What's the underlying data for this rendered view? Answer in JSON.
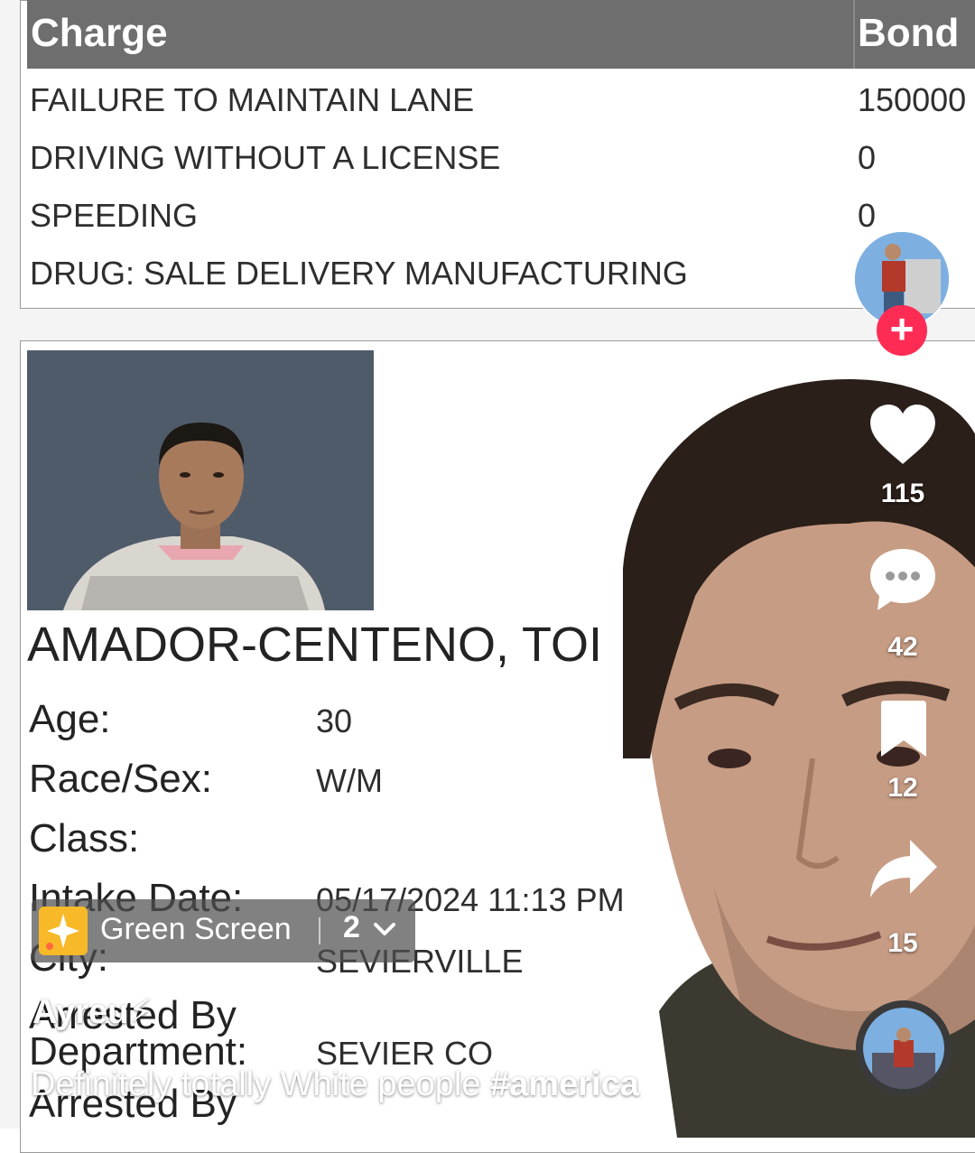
{
  "charges": {
    "header_charge": "Charge",
    "header_bond": "Bond",
    "rows": [
      {
        "charge": "FAILURE TO MAINTAIN LANE",
        "bond": "150000"
      },
      {
        "charge": "DRIVING WITHOUT A LICENSE",
        "bond": "0"
      },
      {
        "charge": "SPEEDING",
        "bond": "0"
      },
      {
        "charge": "DRUG: SALE DELIVERY MANUFACTURING",
        "bond": ""
      }
    ]
  },
  "record": {
    "name": "AMADOR-CENTENO, TOI",
    "fields": [
      {
        "label": "Age:",
        "value": "30"
      },
      {
        "label": "Race/Sex:",
        "value": "W/M"
      },
      {
        "label": "Class:",
        "value": ""
      },
      {
        "label": "Intake Date:",
        "value": "05/17/2024 11:13 PM"
      },
      {
        "label": "City:",
        "value": "SEVIERVILLE"
      },
      {
        "label": "Arrested By",
        "value": ""
      },
      {
        "label": "Department:",
        "value": "SEVIER CO"
      },
      {
        "label": "Arrested By",
        "value": ""
      }
    ]
  },
  "actions": {
    "likes": "115",
    "comments": "42",
    "saves": "12",
    "shares": "15"
  },
  "effect": {
    "name": "Green Screen",
    "count": "2"
  },
  "video": {
    "username": "Ayreu⚡",
    "caption_text": "Definitely totally White people ",
    "hashtag": "#america"
  },
  "colors": {
    "follow": "#fe2c55",
    "table_header": "#6e6e6e",
    "effect_icon": "#f7b928"
  },
  "icons": [
    "heart-icon",
    "comment-icon",
    "bookmark-icon",
    "share-icon",
    "plus-icon",
    "sparkle-icon",
    "chevron-down-icon"
  ]
}
